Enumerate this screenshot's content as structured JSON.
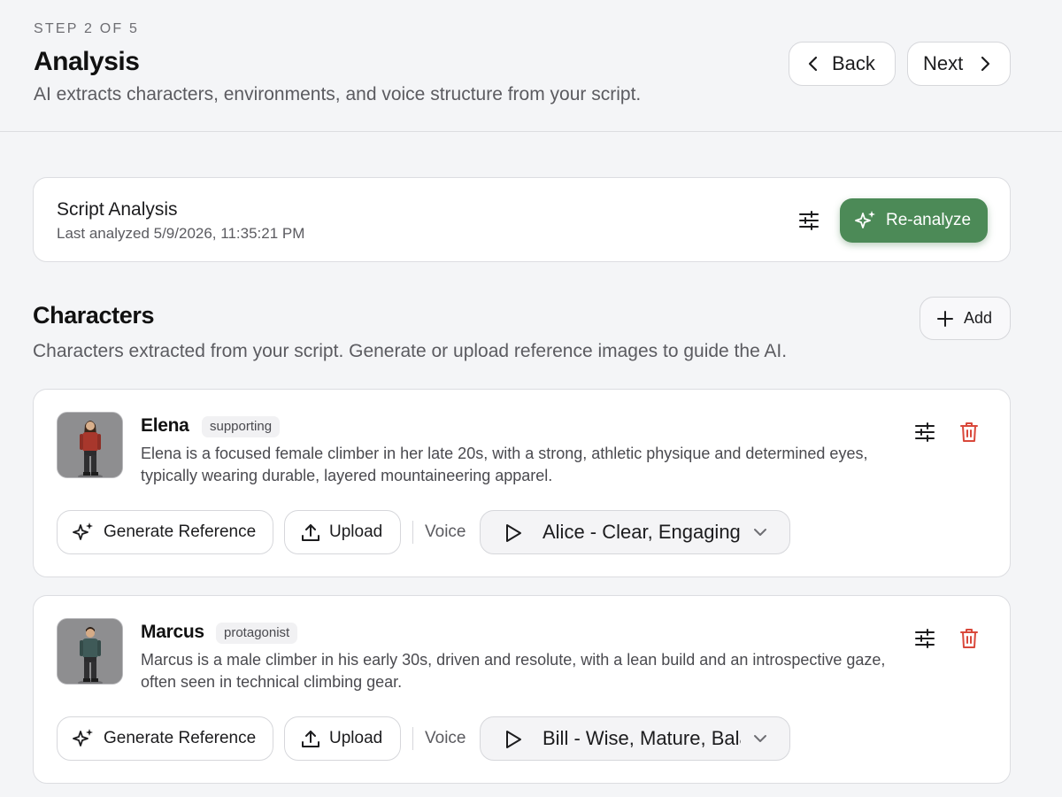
{
  "header": {
    "step": "STEP 2 OF 5",
    "title": "Analysis",
    "subtitle": "AI extracts characters, environments, and voice structure from your script.",
    "back_label": "Back",
    "next_label": "Next"
  },
  "analysis": {
    "title": "Script Analysis",
    "last_analyzed": "Last analyzed 5/9/2026, 11:35:21 PM",
    "reanalyze_label": "Re-analyze"
  },
  "characters": {
    "title": "Characters",
    "description": "Characters extracted from your script. Generate or upload reference images to guide the AI.",
    "add_label": "Add",
    "items": [
      {
        "name": "Elena",
        "role": "supporting",
        "description": "Elena is a focused female climber in her late 20s, with a strong, athletic physique and determined eyes, typically wearing durable, layered mountaineering apparel.",
        "generate_label": "Generate Reference",
        "upload_label": "Upload",
        "voice_label": "Voice",
        "voice_value": "Alice - Clear, Engaging"
      },
      {
        "name": "Marcus",
        "role": "protagonist",
        "description": "Marcus is a male climber in his early 30s, driven and resolute, with a lean build and an introspective gaze, often seen in technical climbing gear.",
        "generate_label": "Generate Reference",
        "upload_label": "Upload",
        "voice_label": "Voice",
        "voice_value": "Bill - Wise, Mature, Balanced"
      }
    ]
  },
  "icons": {
    "back": "chevron-left-icon",
    "next": "chevron-right-icon",
    "tune": "sliders-icon",
    "sparkle": "sparkle-icon",
    "add": "plus-icon",
    "delete": "trash-icon",
    "upload": "upload-icon",
    "play": "play-icon",
    "dropdown": "chevron-down-icon"
  },
  "colors": {
    "accent": "#4c8a57",
    "danger": "#d9483b",
    "background": "#f4f5f7"
  }
}
